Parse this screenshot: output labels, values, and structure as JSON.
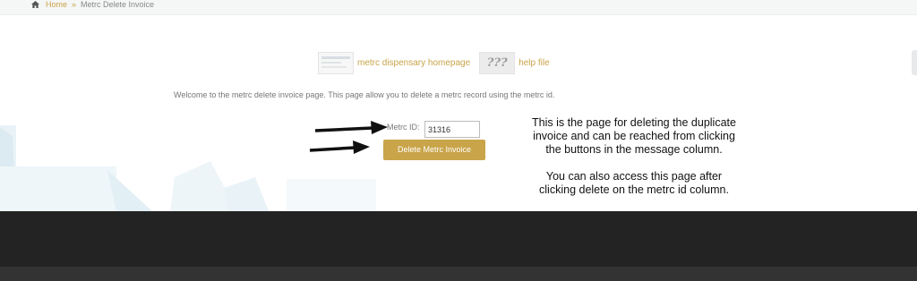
{
  "breadcrumb": {
    "home_label": "Home",
    "separator": "»",
    "current": "Metrc Delete Invoice"
  },
  "links": {
    "homepage_label": "metrc dispensary homepage",
    "help_label": "help file",
    "help_thumb_text": "???"
  },
  "main": {
    "welcome_text": "Welcome to the metrc delete invoice page. This page allow you to delete a metrc record using the metrc id."
  },
  "form": {
    "metrc_id_label": "Metrc ID:",
    "metrc_id_value": "31316",
    "delete_button_label": "Delete Metrc Invoice"
  },
  "annotation": {
    "line1": "This is the page for deleting the duplicate",
    "line2": "invoice and can be reached from clicking",
    "line3": "the buttons in the message column.",
    "line4": "You can also access this page after",
    "line5": "clicking delete on the metrc id column."
  },
  "colors": {
    "accent": "#c9a449",
    "footer": "#232323",
    "footer_bottom": "#333333"
  }
}
